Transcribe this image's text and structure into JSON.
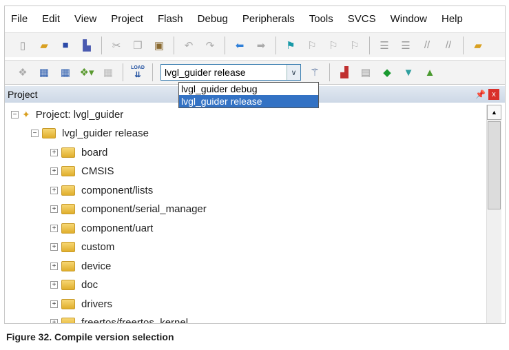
{
  "menu": [
    "File",
    "Edit",
    "View",
    "Project",
    "Flash",
    "Debug",
    "Peripherals",
    "Tools",
    "SVCS",
    "Window",
    "Help"
  ],
  "target_combo": {
    "value": "lvgl_guider release",
    "options": [
      "lvgl_guider debug",
      "lvgl_guider release"
    ],
    "selected_index": 1
  },
  "load_label": "LOAD",
  "panel": {
    "title": "Project",
    "pin": "⍑",
    "close": "x"
  },
  "tree": {
    "root": "Project: lvgl_guider",
    "target": "lvgl_guider release",
    "groups": [
      "board",
      "CMSIS",
      "component/lists",
      "component/serial_manager",
      "component/uart",
      "custom",
      "device",
      "doc",
      "drivers",
      "freertos/freertos_kernel"
    ]
  },
  "caption": "Figure 32.  Compile version selection"
}
